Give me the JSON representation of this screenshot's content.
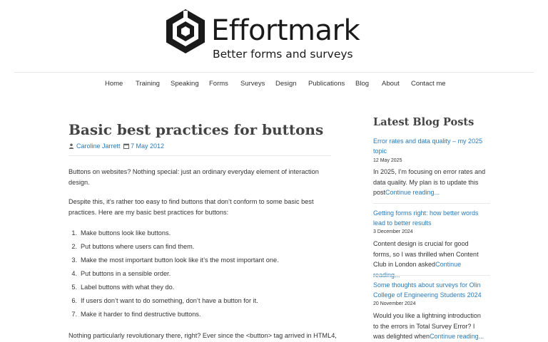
{
  "site": {
    "name": "Effortmark",
    "tagline": "Better forms and surveys"
  },
  "nav": [
    "Home",
    "Training",
    "Speaking",
    "Forms",
    "Surveys",
    "Design",
    "Publications",
    "Blog",
    "About",
    "Contact me"
  ],
  "post": {
    "title": "Basic best practices for buttons",
    "author": "Caroline Jarrett",
    "date": "7 May 2012",
    "intro": "Buttons on websites? Nothing special: just an ordinary everyday element of interaction design.",
    "para2": "Despite this, it’s rather too easy to find buttons that don’t conform to some basic best practices. Here are my basic best practices for buttons:",
    "list": [
      "Make buttons look like buttons.",
      "Put buttons where users can find them.",
      "Make the most important button look like it’s the most important one.",
      "Put buttons in a sensible order.",
      "Label buttons with what they do.",
      "If users don’t want to do something, don’t have a button for it.",
      "Make it harder to find destructive buttons."
    ],
    "para3": "Nothing particularly revolutionary there, right? Ever since the <button> tag arrived in HTML4,"
  },
  "sidebar": {
    "title": "Latest Blog Posts",
    "read_more": "Continue reading...",
    "posts": [
      {
        "title": "Error rates and data quality – my 2025 topic",
        "date": "12 May 2025",
        "excerpt": "In 2025, I’m focusing on error rates and data quality. My plan is to update this post"
      },
      {
        "title": "Getting forms right: how better words lead to better results",
        "date": "3 December 2024",
        "excerpt": "Content design is crucial for good forms, so I was thrilled when Content Club in London asked"
      },
      {
        "title": "Some thoughts about surveys for Olin College of Engineering Students 2024",
        "date": "20 November 2024",
        "excerpt": "Would you like a lightning introduction to the errors in Total Survey Error? I was delighted when"
      }
    ]
  },
  "colors": {
    "link": "#2a7ab8",
    "heading": "#444444",
    "text": "#333333",
    "logo": "#1a1a1a"
  }
}
